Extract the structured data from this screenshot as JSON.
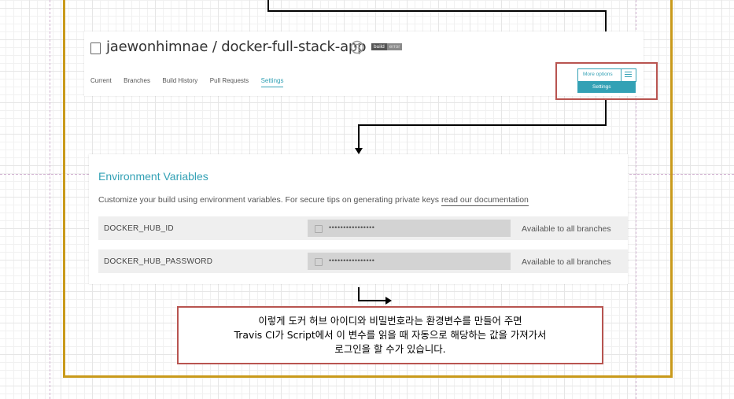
{
  "repo": {
    "title": "jaewonhimnae / docker-full-stack-app",
    "badge_left": "build",
    "badge_right": "error"
  },
  "tabs": [
    "Current",
    "Branches",
    "Build History",
    "Pull Requests",
    "Settings"
  ],
  "menu": {
    "more_options": "More options",
    "settings": "Settings"
  },
  "env": {
    "heading": "Environment Variables",
    "description": "Customize your build using environment variables. For secure tips on generating private keys",
    "doc_link": "read our documentation",
    "rows": [
      {
        "name": "DOCKER_HUB_ID",
        "value": "••••••••••••••••",
        "branches": "Available to all branches"
      },
      {
        "name": "DOCKER_HUB_PASSWORD",
        "value": "••••••••••••••••",
        "branches": "Available to all branches"
      }
    ]
  },
  "note": {
    "line1": "이렇게 도커 허브 아이디와 비밀번호라는 환경변수를 만들어 주면",
    "line2": "Travis CI가 Script에서 이 변수를 읽을 때 자동으로 해당하는 값을 가져가서",
    "line3": "로그인을 할 수가 있습니다."
  },
  "colors": {
    "frame": "#c99a1b",
    "callout": "#b85450",
    "accent": "#33a1b5"
  }
}
